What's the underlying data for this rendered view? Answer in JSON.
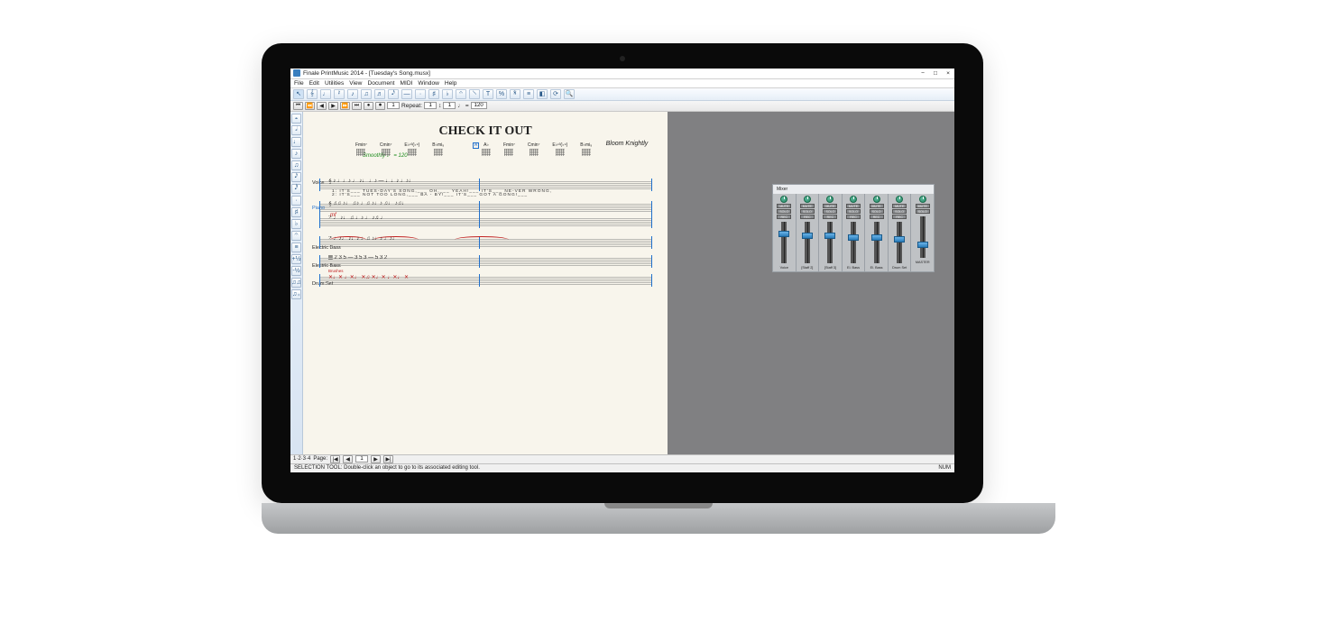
{
  "window": {
    "title": "Finale PrintMusic 2014 - [Tuesday's Song.musx]",
    "controls": {
      "min": "−",
      "max": "□",
      "close": "×"
    }
  },
  "menu": [
    "File",
    "Edit",
    "Utilities",
    "View",
    "Document",
    "MIDI",
    "Window",
    "Help"
  ],
  "toolbar_icons": [
    "↖",
    "𝄞",
    "♩",
    "𝄽",
    "♪",
    "♫",
    "♬",
    "𝅘𝅥𝅯",
    "—",
    "·",
    "♯",
    "♭",
    "𝄐",
    "𝆲",
    "T",
    "%",
    "𝄋",
    "≡",
    "◧",
    "⟳",
    "🔍"
  ],
  "palette_icons": [
    "𝅝",
    "𝅗𝅥",
    "♩",
    "♪",
    "♫",
    "𝅘𝅥𝅯",
    "𝅘𝅥𝅰",
    "·",
    "♯",
    "♭",
    "𝄐",
    "≡",
    "+½",
    "-½",
    "♫♫",
    "♫₊"
  ],
  "playback": {
    "buttons": [
      "⏮",
      "⏪",
      "◀",
      "▶",
      "⏩",
      "⏭",
      "●",
      "⏺"
    ],
    "measure": "1",
    "repeat_label": "Repeat:",
    "repeat_from": "1",
    "repeat_to": "1",
    "tempo_label": "♩ =",
    "tempo": "120"
  },
  "score": {
    "title": "CHECK IT OUT",
    "composer": "Bloom Knightly",
    "tempo_text": "Smoothly ♩ = 120",
    "rehearsal": "A",
    "chords_left": [
      "Fmin⁷",
      "Cmin⁷",
      "E♭¹³(♭⁹)",
      "B♭mi₉"
    ],
    "chords_right": [
      "A♭",
      "Fmin⁷",
      "Cmin⁷",
      "E♭¹³(♭⁹)",
      "B♭mi₉"
    ],
    "parts": [
      "Voice",
      "Piano",
      "Electric Bass",
      "Electric Bass",
      "Drum Set"
    ],
    "lyrics1": "1: IT'S___ TUES-DAY'S SONG,___ OH,___ YEAH!___ IT'S___ NE-VER WRONG,",
    "lyrics2": "2: IT'S___ NOT TOO LONG,___ BA - BY!___ IT'S___ GOT A GONG!___",
    "dynamic": "mf",
    "brushes": "Brushes"
  },
  "mixer": {
    "title": "Mixer",
    "buttons": {
      "mute": "MUTE",
      "solo": "SOLO",
      "rec": "REC"
    },
    "channels": [
      {
        "name": "Voice",
        "fader": 36
      },
      {
        "name": "[Staff 2]",
        "fader": 34
      },
      {
        "name": "[Staff 3]",
        "fader": 34
      },
      {
        "name": "El. Bass",
        "fader": 32
      },
      {
        "name": "El. Bass",
        "fader": 32
      },
      {
        "name": "Drum Set",
        "fader": 30
      },
      {
        "name": "MASTER",
        "fader": 18,
        "master": true
      }
    ]
  },
  "pager": {
    "layout": "1·2·3·4",
    "page_label": "Page:",
    "page": "1",
    "nav": [
      "|◀",
      "◀",
      "▶",
      "▶|"
    ]
  },
  "status": {
    "text": "SELECTION TOOL: Double-click an object to go to its associated editing tool.",
    "num": "NUM"
  }
}
